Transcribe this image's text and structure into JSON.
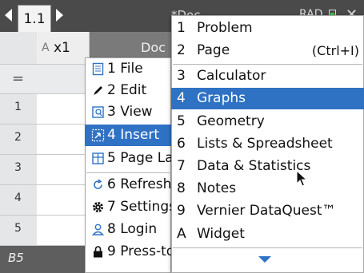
{
  "tabbar": {
    "active_tab": "1.1",
    "doc_title": "*Doc",
    "angle_mode": "RAD",
    "battery_color": "#39c639"
  },
  "spreadsheet": {
    "col_a_letter": "A",
    "col_a_name": "x1",
    "col_b_label": "Doc",
    "eq_sign": "=",
    "rows": [
      "1",
      "2",
      "3",
      "4",
      "5"
    ],
    "cell_ref": "B5"
  },
  "main_menu": {
    "items": [
      {
        "key": "1",
        "label": "File",
        "icon": "file-icon"
      },
      {
        "key": "2",
        "label": "Edit",
        "icon": "pencil-icon"
      },
      {
        "key": "3",
        "label": "View",
        "icon": "view-icon"
      },
      {
        "key": "4",
        "label": "Insert",
        "icon": "insert-icon",
        "highlighted": true
      },
      {
        "key": "5",
        "label": "Page Layout",
        "icon": "page-layout-icon"
      },
      {
        "key": "6",
        "label": "Refresh",
        "icon": "refresh-icon"
      },
      {
        "key": "7",
        "label": "Settings",
        "icon": "gear-icon"
      },
      {
        "key": "8",
        "label": "Login",
        "icon": "user-icon"
      },
      {
        "key": "9",
        "label": "Press-to-Test",
        "icon": "lock-icon"
      }
    ]
  },
  "insert_menu": {
    "items": [
      {
        "key": "1",
        "label": "Problem"
      },
      {
        "key": "2",
        "label": "Page",
        "shortcut": "(Ctrl+I)"
      },
      {
        "key": "3",
        "label": "Calculator"
      },
      {
        "key": "4",
        "label": "Graphs",
        "highlighted": true
      },
      {
        "key": "5",
        "label": "Geometry"
      },
      {
        "key": "6",
        "label": "Lists & Spreadsheet"
      },
      {
        "key": "7",
        "label": "Data & Statistics"
      },
      {
        "key": "8",
        "label": "Notes"
      },
      {
        "key": "9",
        "label": "Vernier DataQuest™"
      },
      {
        "key": "A",
        "label": "Widget"
      }
    ],
    "more_icon": "chevron-down-icon"
  },
  "colors": {
    "highlight": "#2f72c4",
    "tabbar": "#4a4a4a"
  }
}
